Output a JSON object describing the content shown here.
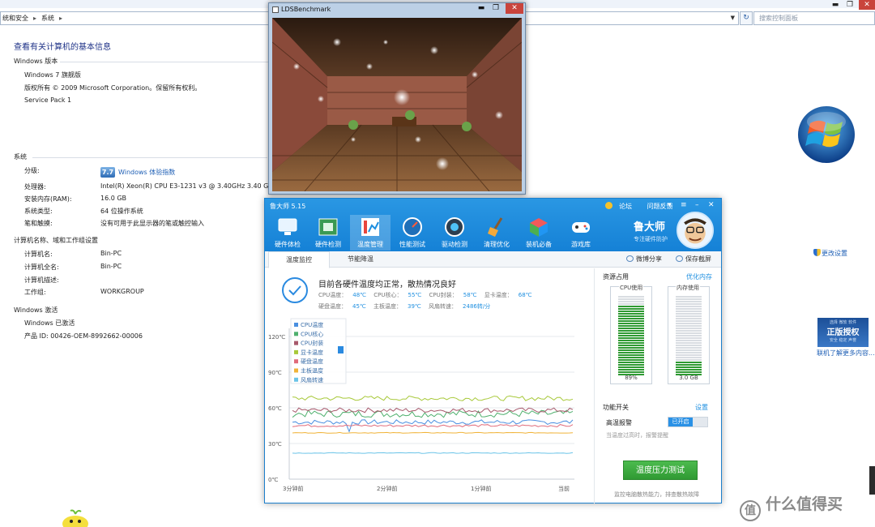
{
  "address_bar": {
    "crumbs": [
      "统和安全",
      "系统"
    ],
    "search_placeholder": "搜索控制面板"
  },
  "system_page": {
    "title": "查看有关计算机的基本信息",
    "edition_section": "Windows 版本",
    "edition": "Windows 7 旗舰版",
    "copyright": "版权所有 © 2009 Microsoft Corporation。保留所有权利。",
    "service_pack": "Service Pack 1",
    "system_section": "系统",
    "rows_system": [
      {
        "label": "分级:",
        "value": "Windows 体验指数"
      },
      {
        "label": "处理器:",
        "value": "Intel(R) Xeon(R) CPU E3-1231 v3 @ 3.40GHz   3.40 GHz"
      },
      {
        "label": "安装内存(RAM):",
        "value": "16.0 GB"
      },
      {
        "label": "系统类型:",
        "value": "64 位操作系统"
      },
      {
        "label": "笔和触摸:",
        "value": "没有可用于此显示器的笔或触控输入"
      }
    ],
    "rating_badge": "7.7",
    "computer_section": "计算机名称、域和工作组设置",
    "rows_computer": [
      {
        "label": "计算机名:",
        "value": "Bin-PC"
      },
      {
        "label": "计算机全名:",
        "value": "Bin-PC"
      },
      {
        "label": "计算机描述:",
        "value": ""
      },
      {
        "label": "工作组:",
        "value": "WORKGROUP"
      }
    ],
    "change_settings": "更改设置",
    "activation_section": "Windows 激活",
    "activated": "Windows 已激活",
    "product_id": "产品 ID: 00426-OEM-8992662-00006",
    "genuine_top": "选择 微软 软件",
    "genuine_main": "正版授权",
    "genuine_bottom": "安全 稳定 声誉",
    "genuine_link": "联机了解更多内容..."
  },
  "lds_benchmark": {
    "title": "LDSBenchmark"
  },
  "ludashi": {
    "title": "鲁大师 5.15",
    "top_links": [
      "论坛",
      "问题反馈"
    ],
    "tabs": [
      {
        "label": "硬件体检",
        "icon": "monitor-icon"
      },
      {
        "label": "硬件检测",
        "icon": "board-icon"
      },
      {
        "label": "温度管理",
        "icon": "thermometer-icon"
      },
      {
        "label": "性能测试",
        "icon": "gauge-icon"
      },
      {
        "label": "驱动检测",
        "icon": "gear-icon"
      },
      {
        "label": "清理优化",
        "icon": "broom-icon"
      },
      {
        "label": "装机必备",
        "icon": "cube-icon"
      },
      {
        "label": "游戏库",
        "icon": "gamepad-icon"
      }
    ],
    "active_tab": "温度管理",
    "brand": "鲁大师",
    "brand_sub": "专注硬件防护",
    "subtabs": [
      "温度监控",
      "节能降温"
    ],
    "share": "微博分享",
    "screenshot": "保存截屏",
    "status_title": "目前各硬件温度均正常，散热情况良好",
    "temps_line1": [
      {
        "label": "CPU温度：",
        "value": "48℃"
      },
      {
        "label": "CPU核心：",
        "value": "55℃"
      },
      {
        "label": "CPU封装：",
        "value": "58℃"
      },
      {
        "label": "显卡温度：",
        "value": "68℃"
      }
    ],
    "temps_line2": [
      {
        "label": "硬盘温度：",
        "value": "45℃"
      },
      {
        "label": "主板温度：",
        "value": "39℃"
      },
      {
        "label": "风扇转速：",
        "value": "2486转/分"
      }
    ],
    "resources_title": "资源占用",
    "optimize_memory": "优化内存",
    "cpu_usage_label": "CPU使用",
    "cpu_usage_value": "89%",
    "cpu_usage_fraction": 0.89,
    "mem_usage_label": "内存使用",
    "mem_usage_value": "3.0 GB",
    "mem_usage_fraction": 0.19,
    "function_title": "功能开关",
    "function_settings": "设置",
    "hot_alarm_label": "高温报警",
    "hot_alarm_state": "已开启",
    "hot_alarm_desc": "当温度过高时，报警提醒",
    "stress_button": "温度压力测试",
    "stress_desc": "监控电脑散热能力，排查散热故障"
  },
  "colors": {
    "ludashi_blue": "#1581d6",
    "accent_link": "#1e8fe0",
    "usage_green": "#2f9a33"
  },
  "chart_data": {
    "type": "line",
    "yticks": [
      "120℃",
      "90℃",
      "60℃",
      "30℃",
      "0℃"
    ],
    "xticks": [
      "3分钟前",
      "2分钟前",
      "1分钟前",
      "当前"
    ],
    "ylim": [
      0,
      120
    ],
    "series": [
      {
        "name": "CPU温度",
        "color": "#4a8fe0",
        "base": 48,
        "noise": 2
      },
      {
        "name": "CPU核心",
        "color": "#4fb06e",
        "base": 55,
        "noise": 3
      },
      {
        "name": "CPU封装",
        "color": "#a7586b",
        "base": 58,
        "noise": 2
      },
      {
        "name": "显卡温度",
        "color": "#a8c93a",
        "base": 68,
        "noise": 2
      },
      {
        "name": "硬盘温度",
        "color": "#e06b7a",
        "base": 45,
        "noise": 1
      },
      {
        "name": "主板温度",
        "color": "#f0b338",
        "base": 39,
        "noise": 0.3
      },
      {
        "name": "风扇转速",
        "color": "#6bc4e8",
        "base": 22,
        "noise": 0.3
      }
    ]
  }
}
